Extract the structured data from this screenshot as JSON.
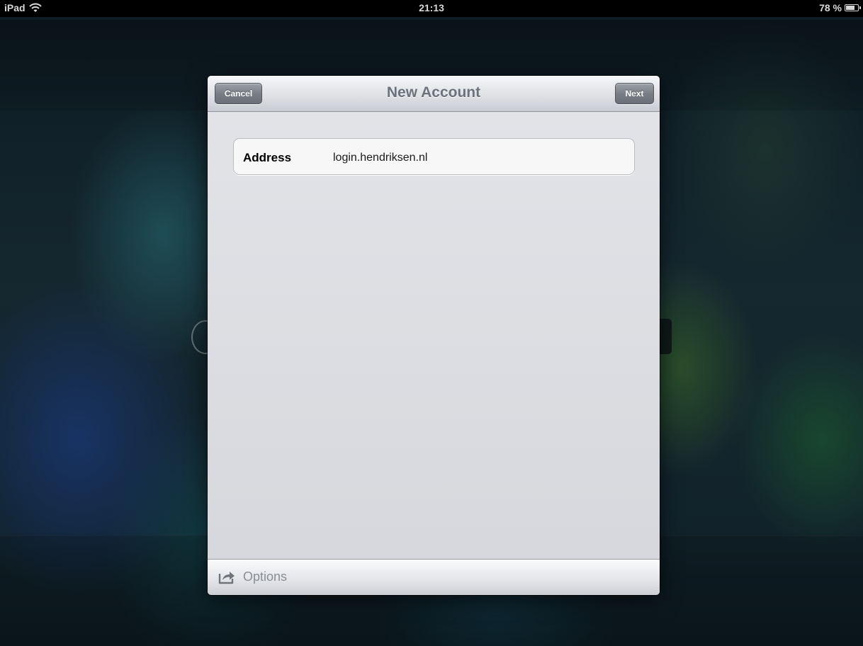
{
  "status_bar": {
    "device": "iPad",
    "time": "21:13",
    "battery": "78 %",
    "battery_level": 0.78,
    "icons": [
      "wifi-icon",
      "battery-icon"
    ]
  },
  "sheet": {
    "title": "New Account",
    "cancel_label": "Cancel",
    "next_label": "Next",
    "fields": [
      {
        "label": "Address",
        "value": "login.hendriksen.nl"
      }
    ],
    "toolbar": {
      "options_label": "Options",
      "options_icon": "share-icon"
    }
  },
  "colors": {
    "nav_title": "#6c727c",
    "button_gray": "#7a7f87",
    "sheet_background": "#dcdee2"
  }
}
